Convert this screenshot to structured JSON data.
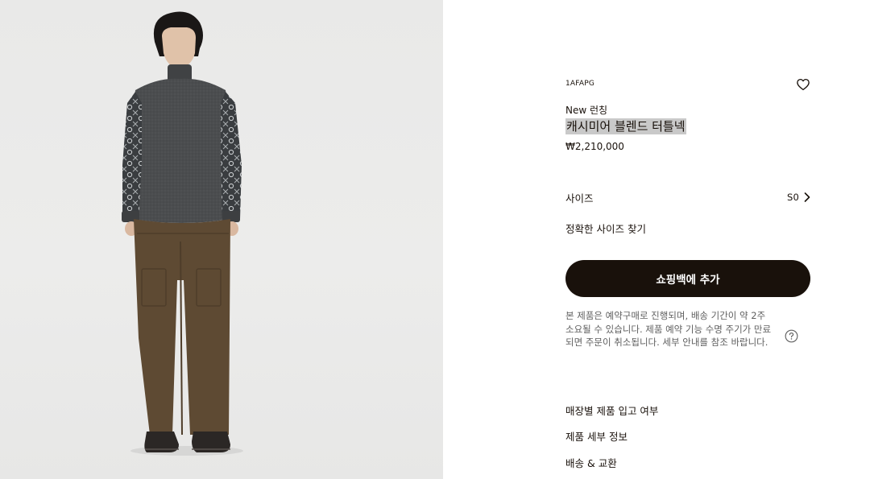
{
  "product": {
    "sku": "1AFAPG",
    "badge": "New 런칭",
    "title": "캐시미어 블렌드 터틀넥",
    "price": "₩2,210,000",
    "wishlist_icon": "heart-icon"
  },
  "size": {
    "label": "사이즈",
    "value": "S0",
    "chevron_icon": "chevron-right-icon",
    "find_label": "정확한 사이즈 찾기"
  },
  "cart": {
    "button_label": "쇼핑백에 추가"
  },
  "notice": {
    "text": "본 제품은 예약구매로 진행되며, 배송 기간이 약 2주 소요될 수 있습니다. 제품 예약 기능 수명 주기가 만료되면 주문이 취소됩니다. 세부 안내를 참조 바랍니다.",
    "help_icon": "question-icon"
  },
  "links": [
    {
      "label": "매장별 제품 입고 여부"
    },
    {
      "label": "제품 세부 정보"
    },
    {
      "label": "배송 & 교환"
    }
  ],
  "colors": {
    "primary": "#19110b",
    "photo_background": "#eaeaea",
    "highlight": "#c9c9c9"
  }
}
